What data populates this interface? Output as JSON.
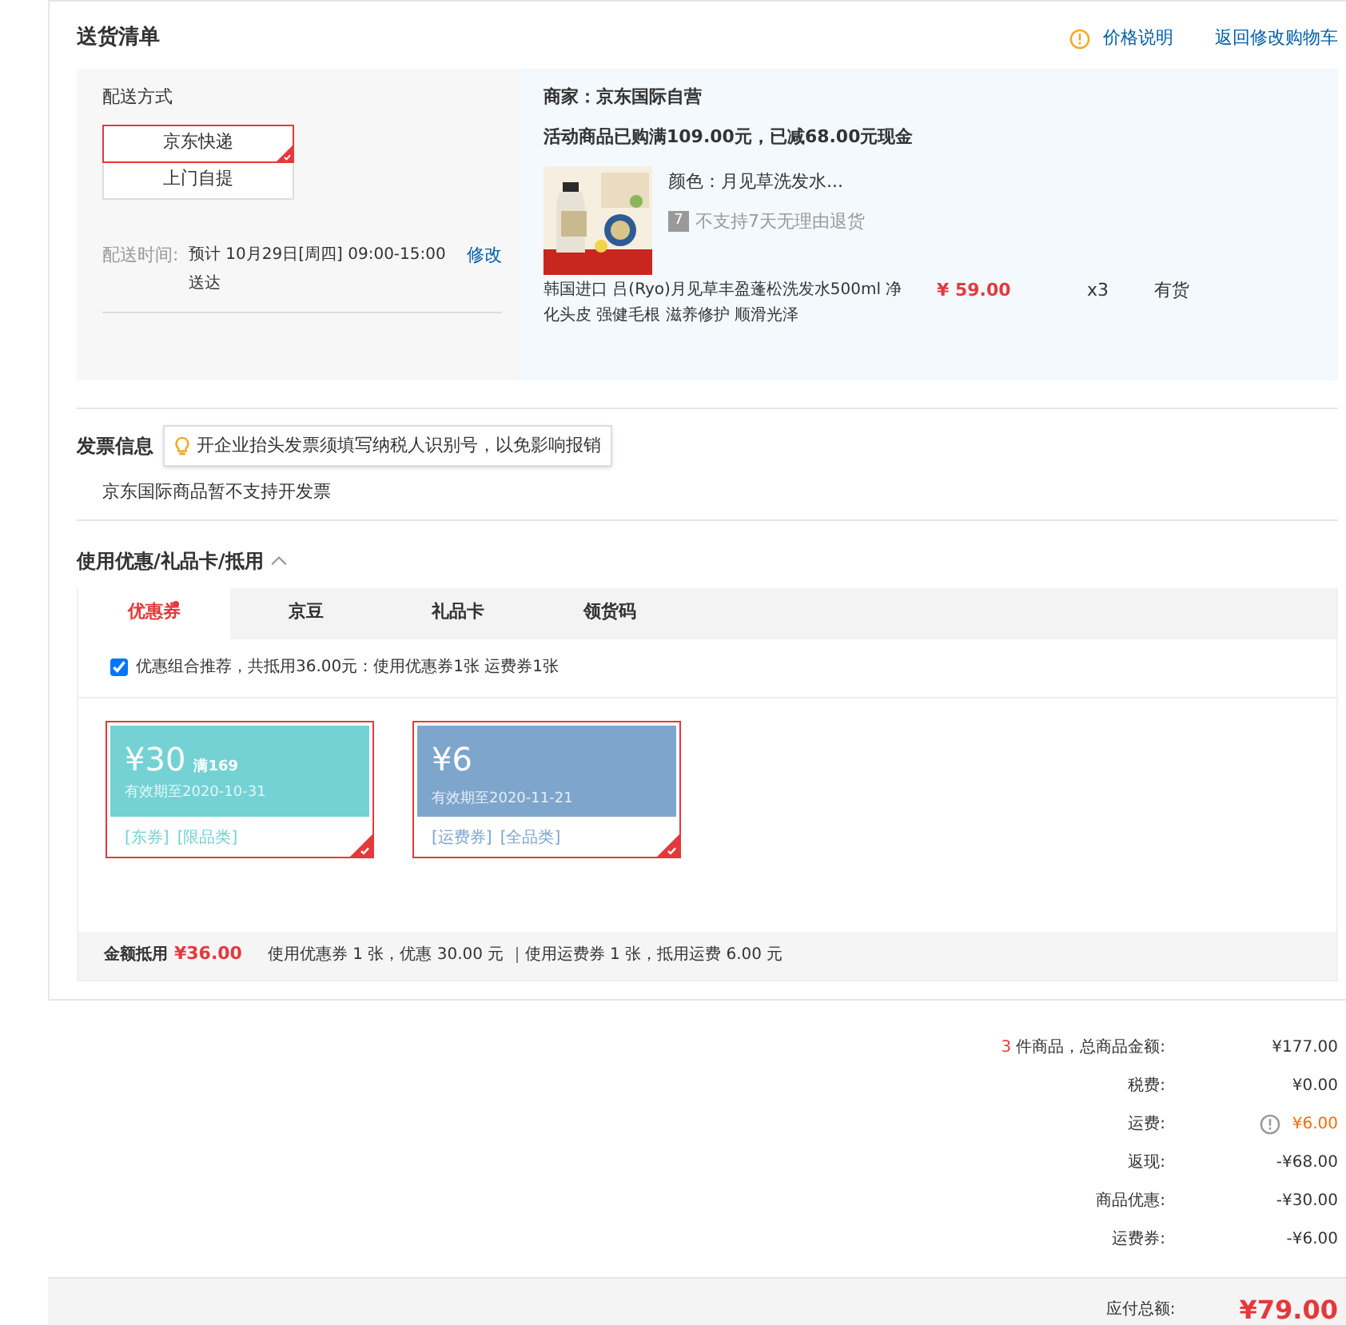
{
  "shipping": {
    "title": "送货清单",
    "links": [
      {
        "label": "价格说明",
        "kind": "info"
      },
      {
        "label": "返回修改购物车",
        "kind": "plain"
      }
    ],
    "delivery": {
      "title": "配送方式",
      "options": [
        {
          "label": "京东快递",
          "selected": true
        },
        {
          "label": "上门自提",
          "selected": false
        }
      ],
      "time_label": "配送时间:",
      "time_value": "预计 10月29日[周四] 09:00-15:00 送达",
      "edit": "修改"
    },
    "merchant": "商家：京东国际自营",
    "promo": "活动商品已购满109.00元，已减68.00元现金",
    "product": {
      "variant": "颜色：月见草洗发水...",
      "return_policy": "不支持7天无理由退货",
      "return_badge": "7",
      "name": "韩国进口 吕(Ryo)月见草丰盈蓬松洗发水500ml 净化头皮 强健毛根 滋养修护 顺滑光泽",
      "price": "¥ 59.00",
      "quantity": "x3",
      "stock": "有货"
    }
  },
  "invoice": {
    "title": "发票信息",
    "tip": "开企业抬头发票须填写纳税人识别号，以免影响报销",
    "note": "京东国际商品暂不支持开发票"
  },
  "discounts": {
    "title": "使用优惠/礼品卡/抵用",
    "expanded": true,
    "tabs": [
      {
        "label": "优惠券",
        "selected": true,
        "dot": true
      },
      {
        "label": "京豆",
        "selected": false,
        "dot": false
      },
      {
        "label": "礼品卡",
        "selected": false,
        "dot": false
      },
      {
        "label": "领货码",
        "selected": false,
        "dot": false
      }
    ],
    "recommend": {
      "checked": true,
      "label": "优惠组合推荐，共抵用36.00元：使用优惠券1张 运费券1张"
    },
    "coupons": [
      {
        "amount": "¥30",
        "condition": "满169",
        "expiry": "有效期至2020-10-31",
        "tags": [
          "[东券]",
          "[限品类]"
        ],
        "color": "#74d2d4",
        "selected": true
      },
      {
        "amount": "¥6",
        "expiry": "有效期至2020-11-21",
        "tags": [
          "[运费券]",
          "[全品类]"
        ],
        "color": "#7ea6cc",
        "selected": true
      }
    ],
    "summary": {
      "label": "金额抵用",
      "amount": "¥36.00",
      "detail": "使用优惠券 1 张，优惠 30.00 元 ｜使用运费券 1 张，抵用运费 6.00 元"
    }
  },
  "totals": [
    {
      "count": "3",
      "label": "件商品，总商品金额:",
      "value": "¥177.00",
      "kind": "plain"
    },
    {
      "label": "税费:",
      "value": "¥0.00",
      "kind": "plain"
    },
    {
      "label": "运费:",
      "value": "¥6.00",
      "kind": "alert"
    },
    {
      "label": "返现:",
      "value": "-¥68.00",
      "kind": "plain"
    },
    {
      "label": "商品优惠:",
      "value": "-¥30.00",
      "kind": "plain"
    },
    {
      "label": "运费券:",
      "value": "-¥6.00",
      "kind": "plain"
    }
  ],
  "payable": {
    "label": "应付总额:",
    "value": "¥79.00"
  }
}
